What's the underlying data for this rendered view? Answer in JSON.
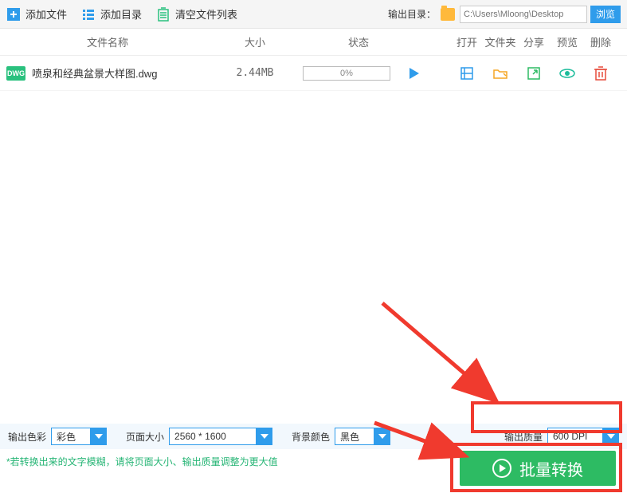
{
  "toolbar": {
    "add_file": "添加文件",
    "add_dir": "添加目录",
    "clear_list": "清空文件列表",
    "out_dir_label": "输出目录：",
    "out_dir_placeholder": "C:\\Users\\Mloong\\Desktop",
    "browse": "浏览"
  },
  "headers": {
    "name": "文件名称",
    "size": "大小",
    "status": "状态",
    "open": "打开",
    "folder": "文件夹",
    "share": "分享",
    "preview": "预览",
    "delete": "删除"
  },
  "files": [
    {
      "icon": "DWG",
      "name": "喷泉和经典盆景大样图.dwg",
      "size": "2.44MB",
      "progress": "0%"
    }
  ],
  "settings": {
    "color_label": "输出色彩",
    "color_value": "彩色",
    "page_label": "页面大小",
    "page_value": "2560 * 1600",
    "bg_label": "背景颜色",
    "bg_value": "黑色",
    "quality_label": "输出质量",
    "quality_value": "600 DPI"
  },
  "hint": "*若转换出来的文字模糊，请将页面大小、输出质量调整为更大值",
  "convert_btn": "批量转换"
}
